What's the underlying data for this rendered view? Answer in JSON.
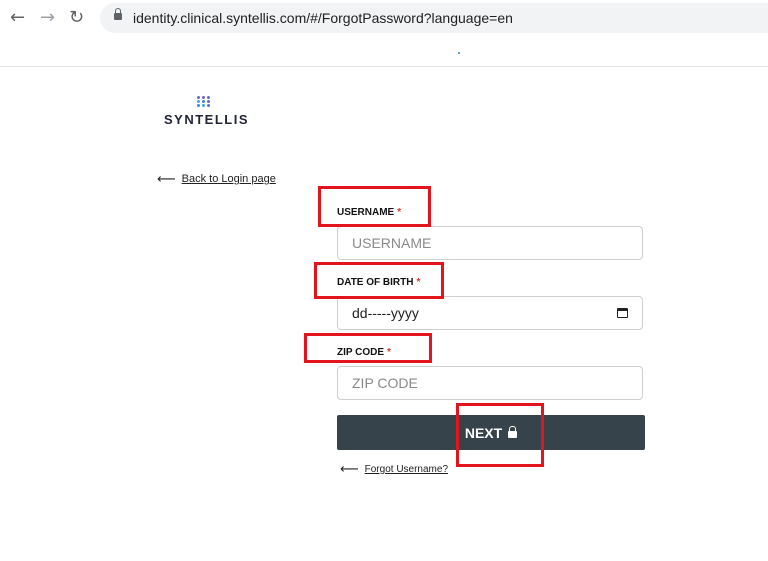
{
  "browser": {
    "back_icon": "arrow-left-icon",
    "forward_icon": "arrow-right-icon",
    "reload_icon": "reload-icon",
    "url": "identity.clinical.syntellis.com/#/ForgotPassword?language=en"
  },
  "brand": {
    "name": "SYNTELLIS",
    "mark_colors": [
      "#5b6fd6",
      "#7b5fd0",
      "#3fa7d6",
      "#4b7fe0"
    ]
  },
  "back_link": {
    "label": "Back to Login page"
  },
  "form": {
    "username": {
      "label": "USERNAME",
      "required": "*",
      "placeholder": "USERNAME"
    },
    "dob": {
      "label": "DATE OF BIRTH",
      "required": "*",
      "value": "dd-----yyyy"
    },
    "zip": {
      "label": "ZIP CODE",
      "required": "*",
      "placeholder": "ZIP CODE"
    },
    "next_label": "NEXT"
  },
  "forgot_link": {
    "label": "Forgot Username?"
  },
  "colors": {
    "highlight": "#e3141b",
    "button": "#37434a",
    "required": "#dd3333"
  }
}
